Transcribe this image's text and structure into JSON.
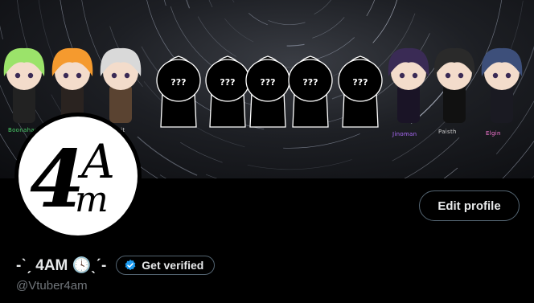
{
  "banner": {
    "characters": [
      {
        "name": "Boonahamo",
        "color": "#4bd06a",
        "state": "revealed"
      },
      {
        "name": "",
        "color": "",
        "state": "revealed"
      },
      {
        "name": "Biscuit",
        "color": "#cfcfcf",
        "state": "revealed"
      },
      {
        "name": "???",
        "color": "#ffffff",
        "state": "hidden"
      },
      {
        "name": "???",
        "color": "#ffffff",
        "state": "hidden"
      },
      {
        "name": "???",
        "color": "#ffffff",
        "state": "hidden"
      },
      {
        "name": "???",
        "color": "#ffffff",
        "state": "hidden"
      },
      {
        "name": "???",
        "color": "#ffffff",
        "state": "hidden"
      },
      {
        "name": "Jinoman",
        "color": "#b06cff",
        "state": "revealed"
      },
      {
        "name": "Paisth",
        "color": "#cfcfcf",
        "state": "revealed"
      },
      {
        "name": "Elgin",
        "color": "#ff7ad9",
        "state": "revealed"
      }
    ]
  },
  "profile": {
    "avatar_logo": "4AM",
    "display_name": "-ˋˏ 4AM 🕓ˎˊ-",
    "handle": "@Vtuber4am",
    "edit_profile_label": "Edit profile",
    "get_verified_label": "Get verified",
    "verified_badge_color": "#1d9bf0"
  }
}
